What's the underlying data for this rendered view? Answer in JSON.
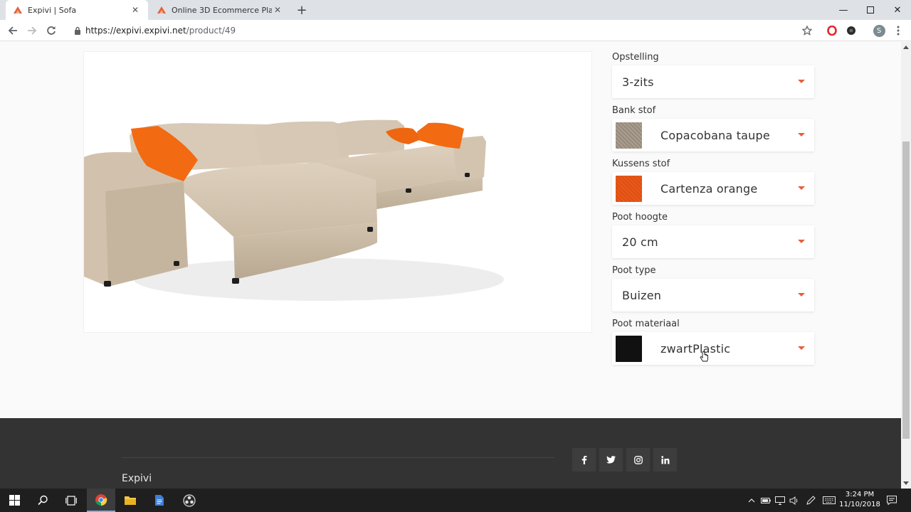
{
  "browser": {
    "tabs": [
      {
        "title": "Expivi | Sofa",
        "active": true
      },
      {
        "title": "Online 3D Ecommerce Platform |",
        "active": false
      }
    ],
    "url_host": "https://expivi.expivi.net",
    "url_path": "/product/49",
    "profile_initial": "S"
  },
  "configurator": {
    "options": [
      {
        "label": "Opstelling",
        "value": "3-zits",
        "swatch": null
      },
      {
        "label": "Bank stof",
        "value": "Copacobana taupe",
        "swatch": "#a59a8c"
      },
      {
        "label": "Kussens stof",
        "value": "Cartenza orange",
        "swatch": "#e8571a"
      },
      {
        "label": "Poot hoogte",
        "value": "20 cm",
        "swatch": null
      },
      {
        "label": "Poot type",
        "value": "Buizen",
        "swatch": null
      },
      {
        "label": "Poot materiaal",
        "value": "zwartPlastic",
        "swatch": "#111111"
      }
    ]
  },
  "footer": {
    "brand": "Expivi",
    "social": [
      "f",
      "t",
      "ig",
      "in"
    ]
  },
  "taskbar": {
    "time": "3:24 PM",
    "date": "11/10/2018"
  },
  "colors": {
    "accent": "#e2603b",
    "footer_bg": "#333333",
    "sofa_fabric": "#d6c7b3",
    "cushion": "#f26a12"
  }
}
